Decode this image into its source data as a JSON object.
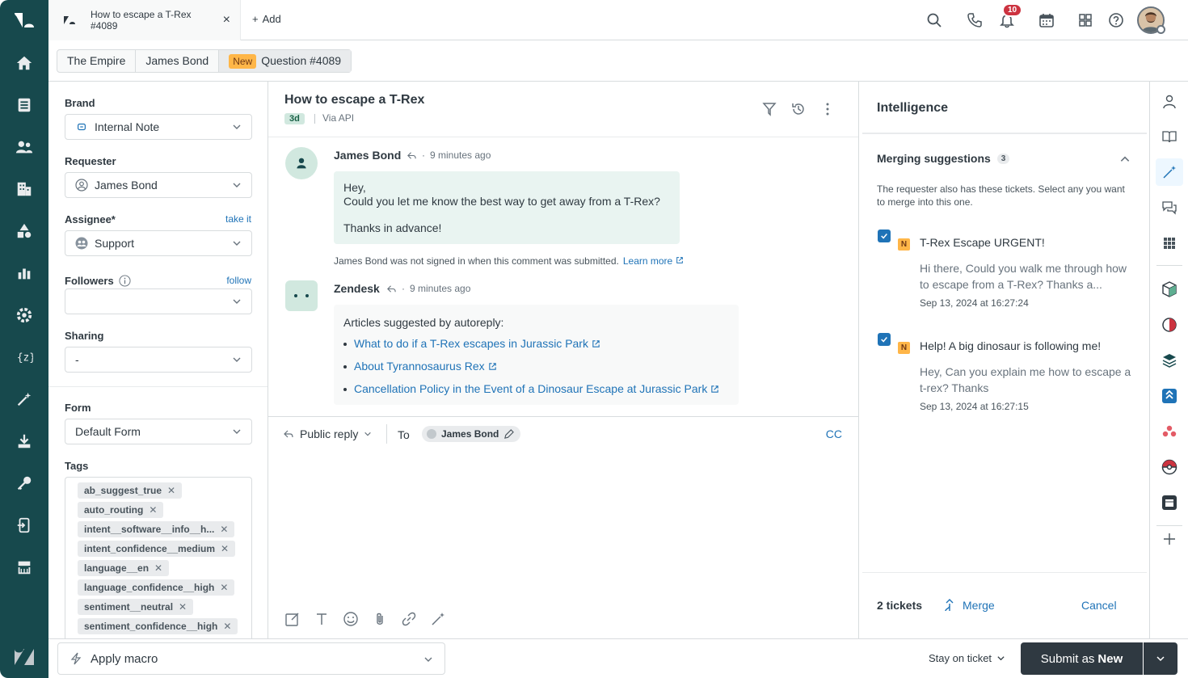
{
  "topbar": {
    "tab": {
      "title": "How to escape a T-Rex",
      "number": "#4089",
      "close": "×"
    },
    "add_label": "Add",
    "notification_count": "10"
  },
  "breadcrumb": {
    "org": "The Empire",
    "requester": "James Bond",
    "status": "New",
    "ticket": "Question #4089"
  },
  "properties": {
    "brand": {
      "label": "Brand",
      "value": "Internal Note"
    },
    "requester": {
      "label": "Requester",
      "value": "James Bond"
    },
    "assignee": {
      "label": "Assignee*",
      "link": "take it",
      "value": "Support"
    },
    "followers": {
      "label": "Followers",
      "link": "follow",
      "value": ""
    },
    "sharing": {
      "label": "Sharing",
      "value": "-"
    },
    "form": {
      "label": "Form",
      "value": "Default Form"
    },
    "tags": {
      "label": "Tags",
      "items": [
        "ab_suggest_true",
        "auto_routing",
        "intent__software__info__h...",
        "intent_confidence__medium",
        "language__en",
        "language_confidence__high",
        "sentiment__neutral",
        "sentiment_confidence__high"
      ]
    }
  },
  "conversation": {
    "title": "How to escape a T-Rex",
    "age": "3d",
    "via": "Via API",
    "messages": [
      {
        "author": "James Bond",
        "time": "9 minutes ago",
        "lines": [
          "Hey,",
          "Could you let me know the best way to get away from a T-Rex?",
          "Thanks in advance!"
        ],
        "note": "James Bond was not signed in when this comment was submitted.",
        "note_link": "Learn more"
      },
      {
        "author": "Zendesk",
        "time": "9 minutes ago",
        "intro": "Articles suggested by autoreply:",
        "articles": [
          "What to do if a T-Rex escapes in Jurassic Park",
          "About Tyrannosaurus Rex",
          "Cancellation Policy in the Event of a Dinosaur Escape at Jurassic Park"
        ]
      }
    ]
  },
  "composer": {
    "reply_type": "Public reply",
    "to_label": "To",
    "recipient": "James Bond",
    "cc": "CC"
  },
  "intelligence": {
    "title": "Intelligence",
    "merge_heading": "Merging suggestions",
    "merge_count": "3",
    "description": "The requester also has these tickets. Select any you want to merge into this one.",
    "suggestions": [
      {
        "status": "N",
        "title": "T-Rex Escape URGENT!",
        "body": "Hi there, Could you walk me through how to escape from a T-Rex? Thanks a...",
        "date": "Sep 13, 2024 at 16:27:24"
      },
      {
        "status": "N",
        "title": "Help! A big dinosaur is following me!",
        "body": "Hey, Can you explain me how to escape a t-rex? Thanks",
        "date": "Sep 13, 2024 at 16:27:15"
      }
    ],
    "tickets_selected": "2 tickets",
    "merge_label": "Merge",
    "cancel_label": "Cancel"
  },
  "footer": {
    "macro_label": "Apply macro",
    "stay_label": "Stay on ticket",
    "submit_prefix": "Submit as",
    "submit_status": "New"
  },
  "colors": {
    "nav_bg": "#17494d",
    "link": "#1f73b7",
    "new_badge": "#ffb648",
    "submit_bg": "#2f3941",
    "bubble": "#e9f4f1"
  }
}
